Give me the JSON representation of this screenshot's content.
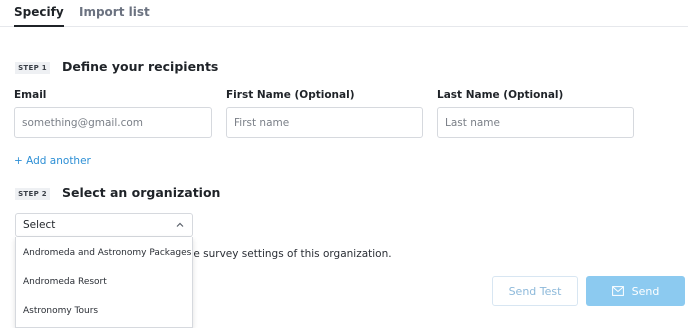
{
  "tabs": [
    {
      "label": "Specify",
      "active": true
    },
    {
      "label": "Import list",
      "active": false
    }
  ],
  "step1": {
    "badge": "STEP 1",
    "title": "Define your recipients",
    "fields": [
      {
        "label": "Email",
        "placeholder": "something@gmail.com"
      },
      {
        "label": "First Name (Optional)",
        "placeholder": "First name"
      },
      {
        "label": "Last Name (Optional)",
        "placeholder": "Last name"
      }
    ],
    "add_another": "+ Add another"
  },
  "step2": {
    "badge": "STEP 2",
    "title": "Select an organization",
    "select": {
      "value": "Select",
      "open": true,
      "options": [
        "Andromeda and Astronomy Packages",
        "Andromeda Resort",
        "Astronomy Tours"
      ]
    },
    "hint": "A test survey will be sent using the survey settings of this organization."
  },
  "buttons": {
    "send_test": "Send Test",
    "send": "Send"
  },
  "icons": {
    "chevron": "chevron-up-icon",
    "send": "mail-icon"
  },
  "colors": {
    "accent": "#2d8fd5",
    "send_button_bg": "#8ccaf0",
    "send_test_text": "#8db9da"
  }
}
